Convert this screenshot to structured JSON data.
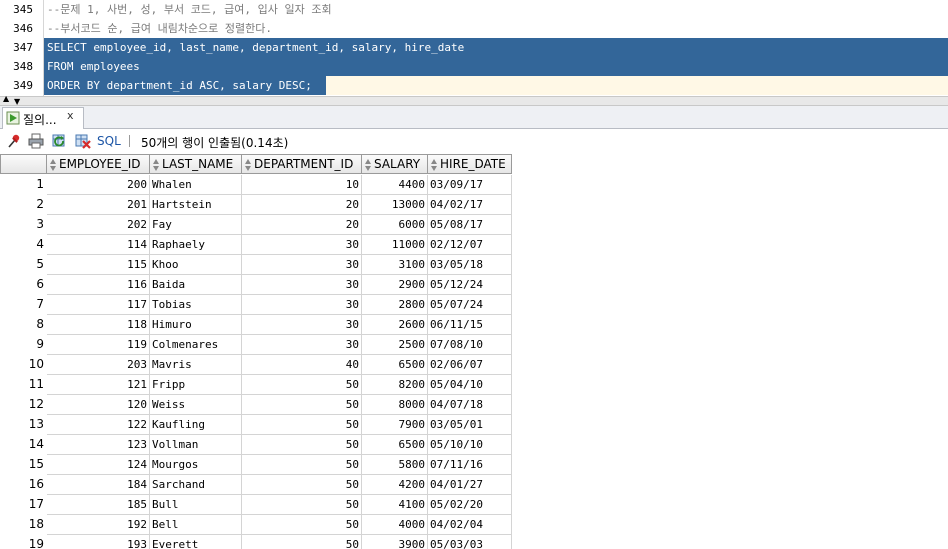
{
  "editor": {
    "lines": [
      {
        "num": "345",
        "text": "--문제 1, 사번, 성, 부서 코드, 급여, 입사 일자 조회",
        "kind": "comment"
      },
      {
        "num": "346",
        "text": "--부서코드 순, 급여 내림차순으로 정렬한다.",
        "kind": "comment"
      },
      {
        "num": "347",
        "text": "SELECT employee_id, last_name, department_id, salary, hire_date",
        "kind": "selected"
      },
      {
        "num": "348",
        "text": "FROM employees",
        "kind": "selected"
      },
      {
        "num": "349",
        "text": "ORDER BY department_id ASC, salary DESC;",
        "kind": "selected-current"
      }
    ],
    "selection_color": "#336699"
  },
  "results": {
    "tab_label": "질의...",
    "tab_close": "x",
    "tab_icon": "run-query-icon",
    "toolbar": {
      "icons": [
        "pin-icon",
        "print-icon",
        "refresh-icon",
        "clear-icon"
      ],
      "sql_label": "SQL",
      "separator": "|",
      "status": "50개의 행이 인출됨(0.14초)"
    },
    "columns": [
      "EMPLOYEE_ID",
      "LAST_NAME",
      "DEPARTMENT_ID",
      "SALARY",
      "HIRE_DATE"
    ],
    "rows": [
      [
        "1",
        "200",
        "Whalen",
        "10",
        "4400",
        "03/09/17"
      ],
      [
        "2",
        "201",
        "Hartstein",
        "20",
        "13000",
        "04/02/17"
      ],
      [
        "3",
        "202",
        "Fay",
        "20",
        "6000",
        "05/08/17"
      ],
      [
        "4",
        "114",
        "Raphaely",
        "30",
        "11000",
        "02/12/07"
      ],
      [
        "5",
        "115",
        "Khoo",
        "30",
        "3100",
        "03/05/18"
      ],
      [
        "6",
        "116",
        "Baida",
        "30",
        "2900",
        "05/12/24"
      ],
      [
        "7",
        "117",
        "Tobias",
        "30",
        "2800",
        "05/07/24"
      ],
      [
        "8",
        "118",
        "Himuro",
        "30",
        "2600",
        "06/11/15"
      ],
      [
        "9",
        "119",
        "Colmenares",
        "30",
        "2500",
        "07/08/10"
      ],
      [
        "10",
        "203",
        "Mavris",
        "40",
        "6500",
        "02/06/07"
      ],
      [
        "11",
        "121",
        "Fripp",
        "50",
        "8200",
        "05/04/10"
      ],
      [
        "12",
        "120",
        "Weiss",
        "50",
        "8000",
        "04/07/18"
      ],
      [
        "13",
        "122",
        "Kaufling",
        "50",
        "7900",
        "03/05/01"
      ],
      [
        "14",
        "123",
        "Vollman",
        "50",
        "6500",
        "05/10/10"
      ],
      [
        "15",
        "124",
        "Mourgos",
        "50",
        "5800",
        "07/11/16"
      ],
      [
        "16",
        "184",
        "Sarchand",
        "50",
        "4200",
        "04/01/27"
      ],
      [
        "17",
        "185",
        "Bull",
        "50",
        "4100",
        "05/02/20"
      ],
      [
        "18",
        "192",
        "Bell",
        "50",
        "4000",
        "04/02/04"
      ],
      [
        "19",
        "193",
        "Everett",
        "50",
        "3900",
        "05/03/03"
      ]
    ]
  }
}
